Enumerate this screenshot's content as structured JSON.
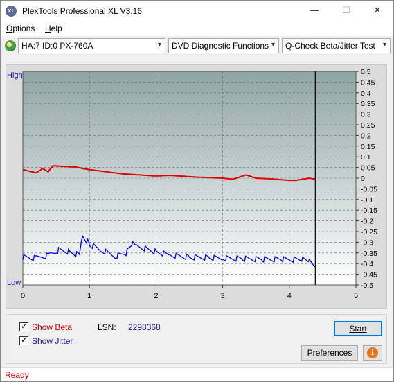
{
  "window": {
    "title": "PlexTools Professional XL V3.16",
    "icon_text": "XL",
    "min_icon": "minimize-icon",
    "max_icon": "maximize-icon",
    "close_icon": "close-icon"
  },
  "menu": {
    "options": {
      "first": "O",
      "rest": "ptions"
    },
    "help": {
      "first": "H",
      "rest": "elp"
    }
  },
  "toolbar": {
    "drive": "HA:7 ID:0  PX-760A",
    "function": "DVD Diagnostic Functions",
    "test": "Q-Check Beta/Jitter Test",
    "arrow": "▾"
  },
  "chart": {
    "left_label_high": "High",
    "left_label_low": "Low",
    "x_ticks": [
      "0",
      "1",
      "2",
      "3",
      "4",
      "5"
    ],
    "y_right_ticks": [
      "0.5",
      "0.45",
      "0.4",
      "0.35",
      "0.3",
      "0.25",
      "0.2",
      "0.15",
      "0.1",
      "0.05",
      "0",
      "-0.05",
      "-0.1",
      "-0.15",
      "-0.2",
      "-0.25",
      "-0.3",
      "-0.35",
      "-0.4",
      "-0.45",
      "-0.5"
    ]
  },
  "chart_data": {
    "type": "line",
    "xlim": [
      0,
      5
    ],
    "ylim": [
      -0.5,
      0.5
    ],
    "marker_x": 4.39,
    "series": [
      {
        "color": "#e00000",
        "x": [
          0,
          0.2,
          0.3,
          0.38,
          0.45,
          0.6,
          0.8,
          0.9,
          1.0,
          1.5,
          2.0,
          2.2,
          2.6,
          3.0,
          3.15,
          3.35,
          3.5,
          3.7,
          4.0,
          4.1,
          4.3,
          4.39
        ],
        "y": [
          0.04,
          0.025,
          0.045,
          0.03,
          0.058,
          0.055,
          0.052,
          0.045,
          0.04,
          0.02,
          0.01,
          0.013,
          0.005,
          0.0,
          -0.005,
          0.015,
          0.0,
          -0.003,
          -0.01,
          -0.01,
          0.0,
          -0.005
        ]
      },
      {
        "color": "#0000ee",
        "x": [
          0,
          0.2,
          0.4,
          0.55,
          0.7,
          0.85,
          0.88,
          0.9,
          1.0,
          1.2,
          1.4,
          1.55,
          1.65,
          1.7,
          1.85,
          2.0,
          2.2,
          2.5,
          2.8,
          3.0,
          3.3,
          3.6,
          3.9,
          4.2,
          4.3,
          4.39
        ],
        "y": [
          -0.37,
          -0.375,
          -0.36,
          -0.335,
          -0.345,
          -0.36,
          -0.29,
          -0.27,
          -0.31,
          -0.34,
          -0.365,
          -0.35,
          -0.31,
          -0.32,
          -0.33,
          -0.345,
          -0.36,
          -0.37,
          -0.372,
          -0.375,
          -0.377,
          -0.38,
          -0.38,
          -0.382,
          -0.39,
          -0.415
        ]
      }
    ]
  },
  "bottom": {
    "show_beta_first": "Show ",
    "show_beta_u": "B",
    "show_beta_rest": "eta",
    "show_jitter_first": "Show ",
    "show_jitter_u": "J",
    "show_jitter_rest": "itter",
    "beta_color": "#c00000",
    "jitter_color": "#1a1a8a",
    "lsn_label": "LSN:",
    "lsn_value": "2298368",
    "start_label": "Start",
    "preferences_label": "Preferences",
    "info_icon": "info-icon",
    "info_glyph": "i",
    "checkmark": "✓"
  },
  "status": {
    "text": "Ready"
  }
}
